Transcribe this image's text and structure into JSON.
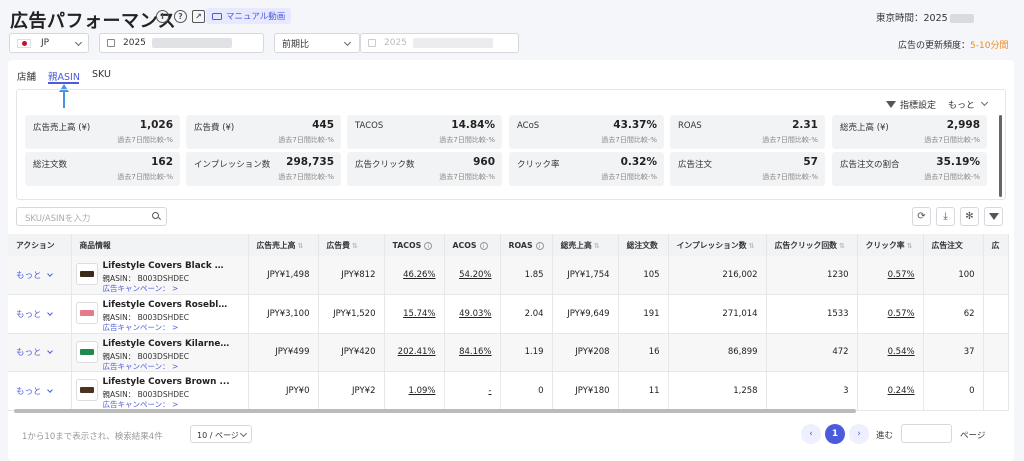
{
  "header": {
    "title": "広告パフォーマンス",
    "manual_label": "マニュアル動画",
    "tokyo_time": "東京時間：2025"
  },
  "filters": {
    "market": "JP",
    "date": "2025",
    "compare": "前期比",
    "compare_date": "2025",
    "freq_label": "広告の更新頻度：",
    "freq_value": "5-10分間"
  },
  "tabs": [
    "店舗",
    "親ASIN",
    "SKU"
  ],
  "metrics_toolbar": {
    "settings": "指標設定",
    "more": "もっと"
  },
  "metrics": [
    {
      "label": "広告売上高 (¥)",
      "value": "1,026",
      "sub": "過去7日間比較-%"
    },
    {
      "label": "広告費 (¥)",
      "value": "445",
      "sub": "過去7日間比較-%"
    },
    {
      "label": "TACOS",
      "value": "14.84%",
      "sub": "過去7日間比較-%"
    },
    {
      "label": "ACoS",
      "value": "43.37%",
      "sub": "過去7日間比較-%"
    },
    {
      "label": "ROAS",
      "value": "2.31",
      "sub": "過去7日間比較-%"
    },
    {
      "label": "総売上高 (¥)",
      "value": "2,998",
      "sub": "過去7日間比較-%"
    },
    {
      "label": "総注文数",
      "value": "162",
      "sub": "過去7日間比較-%"
    },
    {
      "label": "インプレッション数",
      "value": "298,735",
      "sub": "過去7日間比較-%"
    },
    {
      "label": "広告クリック数",
      "value": "960",
      "sub": "過去7日間比較-%"
    },
    {
      "label": "クリック率",
      "value": "0.32%",
      "sub": "過去7日間比較-%"
    },
    {
      "label": "広告注文",
      "value": "57",
      "sub": "過去7日間比較-%"
    },
    {
      "label": "広告注文の割合",
      "value": "35.19%",
      "sub": "過去7日間比較-%"
    }
  ],
  "search": {
    "placeholder": "SKU/ASINを入力"
  },
  "table": {
    "headers": [
      "アクション",
      "商品情報",
      "広告売上高",
      "広告費",
      "TACOS",
      "ACOS",
      "ROAS",
      "総売上高",
      "総注文数",
      "インプレッション数",
      "広告クリック回数",
      "クリック率",
      "広告注文",
      "広"
    ],
    "rows": [
      {
        "action": "もっと",
        "name": "Lifestyle Covers Black M...",
        "asin": "親ASIN： B003DSHDEC",
        "campaign": "広告キャンペーン：  >",
        "color": "#3a2a1a",
        "cells": [
          "JPY¥1,498",
          "JPY¥812",
          "46.26%",
          "54.20%",
          "1.85",
          "JPY¥1,754",
          "105",
          "216,002",
          "1230",
          "0.57%",
          "100"
        ]
      },
      {
        "action": "もっと",
        "name": "Lifestyle Covers Roseblu...",
        "asin": "親ASIN： B003DSHDEC",
        "campaign": "広告キャンペーン：  >",
        "color": "#e57a8a",
        "cells": [
          "JPY¥3,100",
          "JPY¥1,520",
          "15.74%",
          "49.03%",
          "2.04",
          "JPY¥9,649",
          "191",
          "271,014",
          "1533",
          "0.57%",
          "62"
        ]
      },
      {
        "action": "もっと",
        "name": "Lifestyle Covers Kilarney...",
        "asin": "親ASIN： B003DSHDEC",
        "campaign": "広告キャンペーン：  >",
        "color": "#1f8a4c",
        "cells": [
          "JPY¥499",
          "JPY¥420",
          "202.41%",
          "84.16%",
          "1.19",
          "JPY¥208",
          "16",
          "86,899",
          "472",
          "0.54%",
          "37"
        ]
      },
      {
        "action": "もっと",
        "name": "Lifestyle Covers Brown ...",
        "asin": "親ASIN： B003DSHDEC",
        "campaign": "広告キャンペーン：  >",
        "color": "#4a3420",
        "cells": [
          "JPY¥0",
          "JPY¥2",
          "1.09%",
          "-",
          "0",
          "JPY¥180",
          "11",
          "1,258",
          "3",
          "0.24%",
          "0"
        ]
      }
    ]
  },
  "footer": {
    "count_text": "1から10まで表示され、検索結果4件",
    "page_size": "10 / ページ",
    "current_page": "1",
    "goto": "進む",
    "page_label": "ページ"
  }
}
